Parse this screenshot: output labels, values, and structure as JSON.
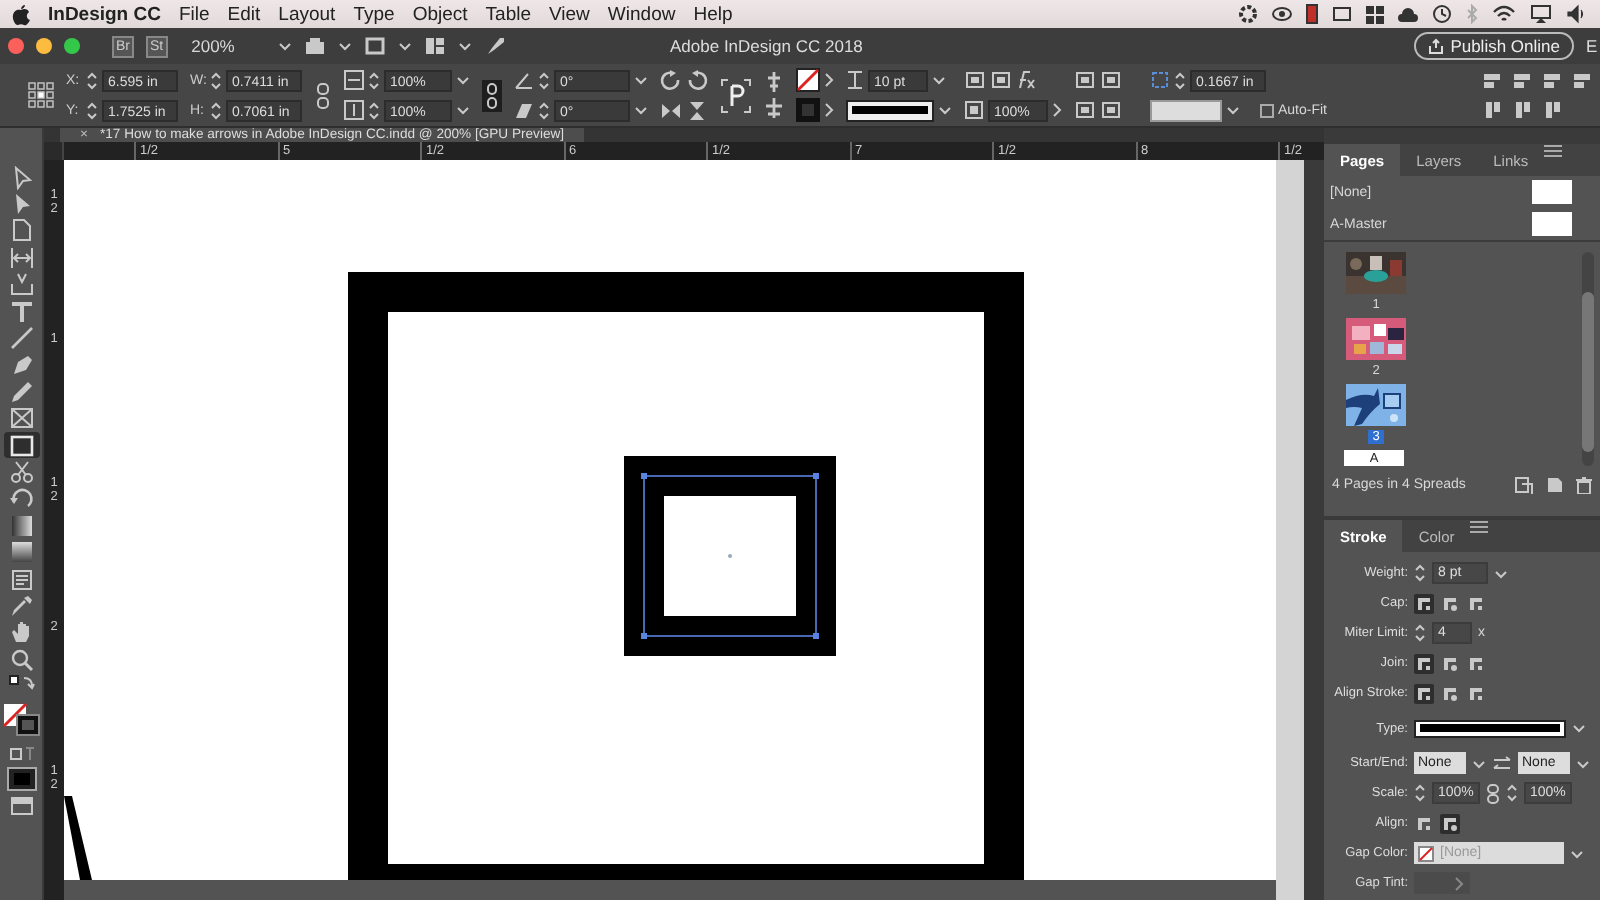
{
  "menu_bar": {
    "app_name": "InDesign CC",
    "menus": [
      "File",
      "Edit",
      "Layout",
      "Type",
      "Object",
      "Table",
      "View",
      "Window",
      "Help"
    ]
  },
  "app_bar": {
    "bridge": "Br",
    "stock": "St",
    "zoom": "200%",
    "title": "Adobe InDesign CC 2018",
    "publish_button": "Publish Online",
    "cut_label": "E"
  },
  "control_panel": {
    "position": [
      {
        "label": "X:",
        "value": "6.595 in"
      },
      {
        "label": "Y:",
        "value": "1.7525 in"
      }
    ],
    "size": [
      {
        "label": "W:",
        "value": "0.7411 in"
      },
      {
        "label": "H:",
        "value": "0.7061 in"
      }
    ],
    "scale": [
      "100%",
      "100%"
    ],
    "angles": [
      "0°",
      "0°"
    ],
    "stroke_weight": "10 pt",
    "opacity": "100%",
    "fitting_offset": "0.1667 in",
    "auto_fit": {
      "label": "Auto-Fit",
      "checked": false
    }
  },
  "document_tab": {
    "close": "×",
    "title": "*17 How to make arrows in Adobe InDesign CC.indd @ 200% [GPU Preview]"
  },
  "rulers": {
    "horizontal": [
      "1/2",
      "5",
      "1/2",
      "6",
      "1/2",
      "7",
      "1/2",
      "8",
      "1/2"
    ],
    "vertical": [
      "12",
      "1",
      "12",
      "2",
      "12"
    ]
  },
  "tools": [
    {
      "kind": "selection",
      "selected": false
    },
    {
      "kind": "direct",
      "selected": false
    },
    {
      "kind": "page",
      "selected": false
    },
    {
      "kind": "gap",
      "selected": false
    },
    {
      "kind": "collector",
      "selected": false
    },
    {
      "kind": "type",
      "selected": false
    },
    {
      "kind": "line",
      "selected": false
    },
    {
      "kind": "pen",
      "selected": false
    },
    {
      "kind": "pencil",
      "selected": false
    },
    {
      "kind": "frame",
      "selected": false
    },
    {
      "kind": "rectangle",
      "selected": true
    },
    {
      "kind": "scissors",
      "selected": false
    },
    {
      "kind": "transform",
      "selected": false
    },
    {
      "kind": "gradient",
      "selected": false
    },
    {
      "kind": "feather",
      "selected": false
    },
    {
      "kind": "note",
      "selected": false
    },
    {
      "kind": "eyedropper",
      "selected": false
    },
    {
      "kind": "hand",
      "selected": false
    },
    {
      "kind": "zoom",
      "selected": false
    },
    {
      "kind": "swap",
      "selected": false
    },
    {
      "kind": "fillstroke",
      "selected": false
    },
    {
      "kind": "format",
      "selected": false
    },
    {
      "kind": "screen",
      "selected": false
    },
    {
      "kind": "view",
      "selected": false
    }
  ],
  "pages_panel": {
    "tabs": [
      {
        "label": "Pages",
        "selected": true
      },
      {
        "label": "Layers",
        "selected": false
      },
      {
        "label": "Links",
        "selected": false
      }
    ],
    "masters": [
      {
        "name": "[None]"
      },
      {
        "name": "A-Master"
      }
    ],
    "pages": [
      {
        "number": "1",
        "selected": false
      },
      {
        "number": "2",
        "selected": false
      },
      {
        "number": "3",
        "selected": true
      }
    ],
    "partial_page_label": "A",
    "footer": "4 Pages in 4 Spreads"
  },
  "stroke_panel": {
    "tabs": [
      {
        "label": "Stroke",
        "selected": true
      },
      {
        "label": "Color",
        "selected": false
      }
    ],
    "rows": [
      {
        "kind": "field",
        "label": "Weight:",
        "value": "8 pt"
      },
      {
        "kind": "cap",
        "label": "Cap:",
        "options": [
          {
            "selected": true
          },
          {
            "selected": false
          },
          {
            "selected": false
          }
        ]
      },
      {
        "kind": "miter",
        "label": "Miter Limit:",
        "value": "4",
        "suffix": "x"
      },
      {
        "kind": "join",
        "label": "Join:",
        "options": [
          {
            "selected": true
          },
          {
            "selected": false
          },
          {
            "selected": false
          }
        ]
      },
      {
        "kind": "align-stroke",
        "label": "Align Stroke:",
        "options": [
          {
            "selected": true
          },
          {
            "selected": false
          },
          {
            "selected": false
          }
        ]
      },
      {
        "kind": "type",
        "label": "Type:"
      },
      {
        "kind": "pair",
        "label": "Start/End:",
        "values": [
          "None",
          "None"
        ]
      },
      {
        "kind": "scale",
        "label": "Scale:",
        "values": [
          "100%",
          "100%"
        ]
      },
      {
        "kind": "align",
        "label": "Align:",
        "options": [
          {
            "selected": false
          },
          {
            "selected": true
          }
        ]
      },
      {
        "kind": "swatch",
        "label": "Gap Color:",
        "value": "[None]"
      },
      {
        "kind": "tint",
        "label": "Gap Tint:"
      }
    ]
  }
}
